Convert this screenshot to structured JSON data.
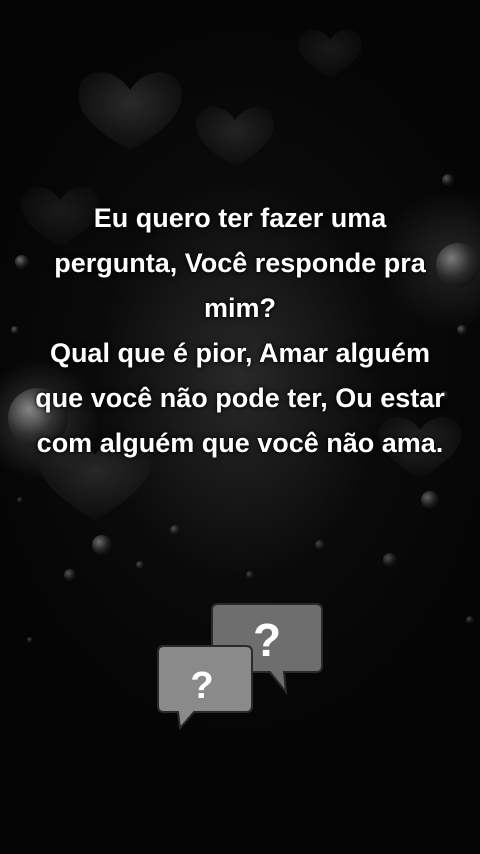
{
  "message": {
    "question_intro": "Eu quero ter fazer uma pergunta, Você responde pra mim?",
    "question_body": "Qual que é pior, Amar alguém que você não pode ter, Ou estar com alguém que você não ama."
  },
  "icons": {
    "background": "hearts-raindrops-background",
    "question_bubbles": "question-chat-bubbles-icon"
  },
  "colors": {
    "background": "#050505",
    "text": "#ffffff",
    "bubble_front": "#7a7a7a",
    "bubble_back": "#5a5a5a"
  }
}
